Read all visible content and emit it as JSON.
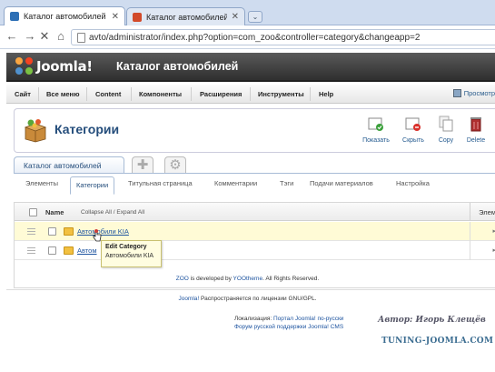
{
  "browser": {
    "tabs": [
      {
        "title": "Каталог автомобилей - Ад",
        "active": true
      },
      {
        "title": "Каталог автомобилей",
        "active": false
      }
    ],
    "url": "avto/administrator/index.php?option=com_zoo&controller=category&changeapp=2"
  },
  "header": {
    "logo_text": "Joomla!",
    "site_name": "Каталог автомобилей"
  },
  "menu": {
    "items": [
      "Сайт",
      "Все меню",
      "Content",
      "Компоненты",
      "Расширения",
      "Инструменты",
      "Help"
    ],
    "preview": "Просмотр"
  },
  "toolbar": {
    "page_title": "Категории",
    "buttons": [
      "Показать",
      "Скрыть",
      "Copy",
      "Delete"
    ]
  },
  "app_tab": "Каталог автомобилей",
  "subtabs": {
    "items": [
      "Элементы",
      "Категории",
      "Титульная страница",
      "Комментарии",
      "Тэги",
      "Подачи материалов",
      "Настройка"
    ],
    "active": "Категории"
  },
  "table": {
    "header_name": "Name",
    "collapse_expand": "Collapse All / Expand All",
    "right_header": "Элем",
    "rows": [
      {
        "name": "Автомобили KIA"
      },
      {
        "name": "Автом"
      }
    ]
  },
  "tooltip": {
    "title": "Edit Category",
    "text": "Автомобили KIA"
  },
  "footer": {
    "zoo_a": "ZOO",
    "zoo_b": " is developed by ",
    "zoo_c": "YOOtheme",
    "zoo_d": ". All Rights Reserved.",
    "lic_a": "Joomla!",
    "lic_b": " Распространяется по лицензии GNU/GPL.",
    "loc_label": "Локализация: ",
    "loc_link1": "Портал Joomla! по-русски",
    "loc_link2": "Форум русской поддержки Joomla! CMS",
    "author": "Автор: Игорь Клещёв",
    "brand": "TUNING-JOOMLA.COM"
  },
  "colors": {
    "accent": "#244d7b",
    "link": "#1f55a0",
    "highlight_row": "#fffbd6",
    "header_bg": "#3f3f3f"
  }
}
